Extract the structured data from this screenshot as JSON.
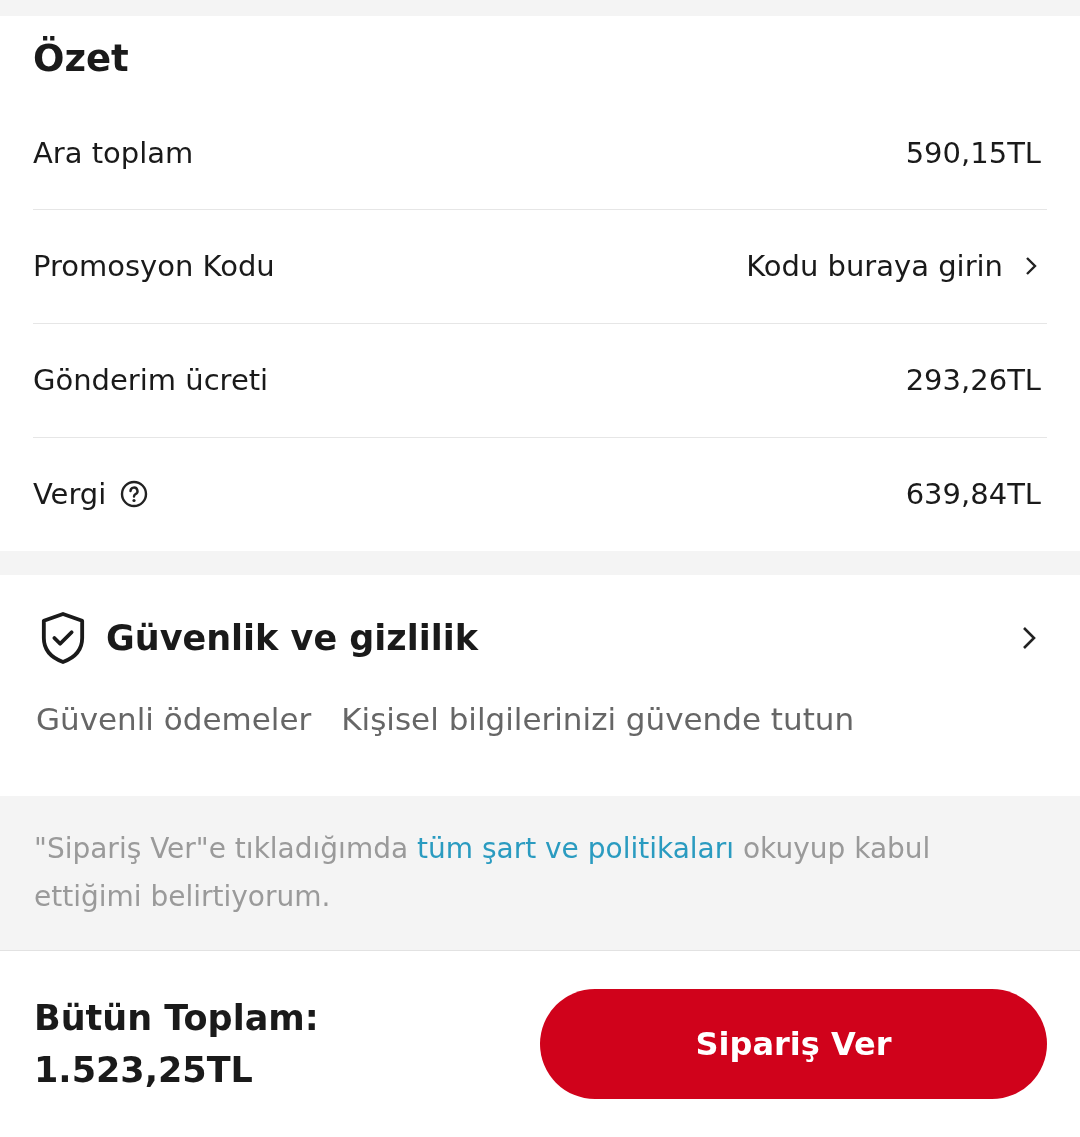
{
  "summary": {
    "title": "Özet",
    "rows": [
      {
        "kind": "plain",
        "label": "Ara toplam",
        "value": "590,15TL"
      },
      {
        "kind": "promo",
        "label": "Promosyon Kodu",
        "value": "Kodu buraya girin"
      },
      {
        "kind": "plain",
        "label": "Gönderim ücreti",
        "value": "293,26TL"
      },
      {
        "kind": "info",
        "label": "Vergi",
        "value": "639,84TL"
      }
    ]
  },
  "security": {
    "title": "Güvenlik ve gizlilik",
    "features": [
      "Güvenli ödemeler",
      "Kişisel bilgilerinizi güvende tutun"
    ]
  },
  "notice": {
    "before": "\"Sipariş Ver\"e tıkladığımda ",
    "link": "tüm şart ve politikaları",
    "after": " okuyup kabul ettiğimi belirtiyorum."
  },
  "footer": {
    "total_label": "Bütün Toplam:",
    "total_value": "1.523,25TL",
    "button": "Sipariş Ver"
  }
}
